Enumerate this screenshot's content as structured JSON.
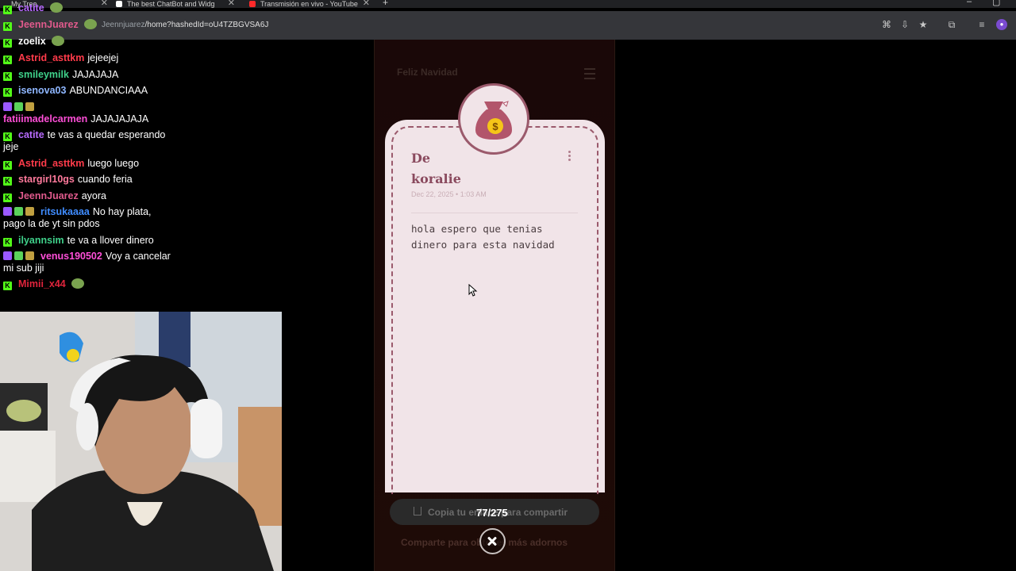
{
  "browser": {
    "tabs": [
      {
        "label": "My Tree"
      },
      {
        "label": "The best ChatBot and Widg"
      },
      {
        "label": "Transmisión en vivo - YouTube"
      }
    ],
    "url_host": "Jeennjuarez",
    "url_path": "/home?hashedId=oU4TZBGVSA6J"
  },
  "chat": [
    {
      "user": "catite",
      "color": "#b86bff",
      "badges": [
        "kick"
      ],
      "text": ""
    },
    {
      "user": "JeennJuarez",
      "color": "#e05a8c",
      "badges": [
        "kick"
      ],
      "text": ""
    },
    {
      "user": "zoelix",
      "color": "#ffffff",
      "badges": [
        "kick"
      ],
      "text": ""
    },
    {
      "user": "Astrid_asttkm",
      "color": "#ff3b4a",
      "badges": [
        "kick"
      ],
      "text": "jejeejej"
    },
    {
      "user": "smileymilk",
      "color": "#3fd18a",
      "badges": [
        "kick"
      ],
      "text": "JAJAJAJA"
    },
    {
      "user": "isenova03",
      "color": "#8fb7ff",
      "badges": [
        "kick"
      ],
      "text": "ABUNDANCIAAA"
    },
    {
      "user": "fatiiimadelcarmen",
      "color": "#ff4fd8",
      "badges": [
        "twitch"
      ],
      "text": "JAJAJAJAJA"
    },
    {
      "user": "catite",
      "color": "#b86bff",
      "badges": [
        "kick"
      ],
      "text": "te vas a quedar esperando jeje"
    },
    {
      "user": "Astrid_asttkm",
      "color": "#ff3b4a",
      "badges": [
        "kick"
      ],
      "text": "luego luego"
    },
    {
      "user": "stargirl10gs",
      "color": "#ff7a9c",
      "badges": [
        "kick"
      ],
      "text": "cuando feria"
    },
    {
      "user": "JeennJuarez",
      "color": "#e05a8c",
      "badges": [
        "kick"
      ],
      "text": "ayora"
    },
    {
      "user": "ritsukaaaa",
      "color": "#3f8cff",
      "badges": [
        "twitch"
      ],
      "text": "No hay plata, pago la de yt sin pdos"
    },
    {
      "user": "ilyannsim",
      "color": "#3fd18a",
      "badges": [
        "kick"
      ],
      "text": "te va a llover dinero"
    },
    {
      "user": "venus190502",
      "color": "#ff4fd8",
      "badges": [
        "twitch"
      ],
      "text": "Voy a cancelar mi sub jiji"
    },
    {
      "user": "Mimii_x44",
      "color": "#e0243c",
      "badges": [
        "kick"
      ],
      "text": ""
    }
  ],
  "site": {
    "title": "Feliz Navidad",
    "note": {
      "from_label": "De",
      "from_name": "koralie",
      "date": "Dec 22, 2025 • 1:03 AM",
      "message": "hola espero que tenias dinero para esta navidad"
    },
    "share_label": "Copia tu enlace para compartir",
    "counter": "77/275",
    "footer_link": "Comparte para obtener más adornos"
  },
  "colors": {
    "card_bg": "#f1e4e8",
    "card_border": "#9b5a6c",
    "kick_green": "#53fc18"
  },
  "icons": [
    "money-bag-icon",
    "close-icon",
    "share-icon",
    "kebab-menu-icon",
    "hamburger-menu-icon"
  ]
}
